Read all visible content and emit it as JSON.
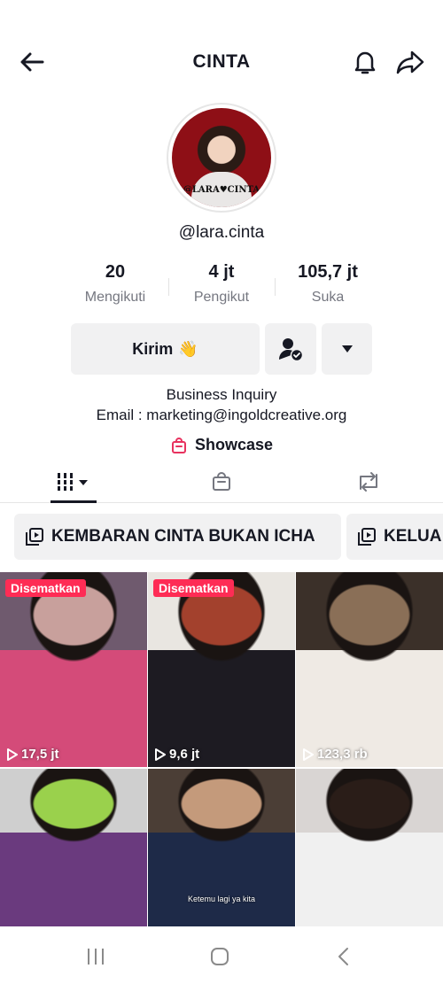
{
  "header": {
    "title": "CINTA"
  },
  "profile": {
    "avatar_caption": "@LARA♥CINTA",
    "username": "@lara.cinta",
    "stats": [
      {
        "value": "20",
        "label": "Mengikuti"
      },
      {
        "value": "4 jt",
        "label": "Pengikut"
      },
      {
        "value": "105,7 jt",
        "label": "Suka"
      }
    ],
    "actions": {
      "message_label": "Kirim",
      "message_emoji": "👋"
    },
    "bio": {
      "line1": "Business Inquiry",
      "line2": "Email : marketing@ingoldcreative.org"
    },
    "showcase_label": "Showcase"
  },
  "tabs": [
    {
      "name": "videos",
      "icon": "grid-icon"
    },
    {
      "name": "shop",
      "icon": "bag-icon"
    },
    {
      "name": "reposts",
      "icon": "repost-icon"
    }
  ],
  "playlists": [
    {
      "label": "KEMBARAN CINTA BUKAN ICHA"
    },
    {
      "label": "KELUA"
    }
  ],
  "videos": [
    {
      "pinned_label": "Disematkan",
      "views": "17,5 jt",
      "colors": [
        "#6f5a6e",
        "#c8a09c",
        "#d44b79"
      ]
    },
    {
      "pinned_label": "Disematkan",
      "views": "9,6 jt",
      "colors": [
        "#e9e6e1",
        "#a3412d",
        "#1d1b22"
      ]
    },
    {
      "pinned_label": "",
      "views": "123,3 rb",
      "colors": [
        "#3b3029",
        "#8a6f57",
        "#efeae4"
      ]
    },
    {
      "pinned_label": "",
      "views": "",
      "colors": [
        "#cfcfcf",
        "#9ad14c",
        "#6a3a7e"
      ]
    },
    {
      "pinned_label": "",
      "views": "",
      "caption": "Ketemu lagi ya kita",
      "colors": [
        "#4b3e36",
        "#c49a7b",
        "#1e2a48"
      ]
    },
    {
      "pinned_label": "",
      "views": "",
      "colors": [
        "#d9d5d3",
        "#2a1d18",
        "#f0f0f0"
      ]
    }
  ],
  "colors": {
    "accent": "#fe2c55",
    "text": "#161823",
    "muted": "#757780",
    "button_bg": "#f1f1f2"
  }
}
